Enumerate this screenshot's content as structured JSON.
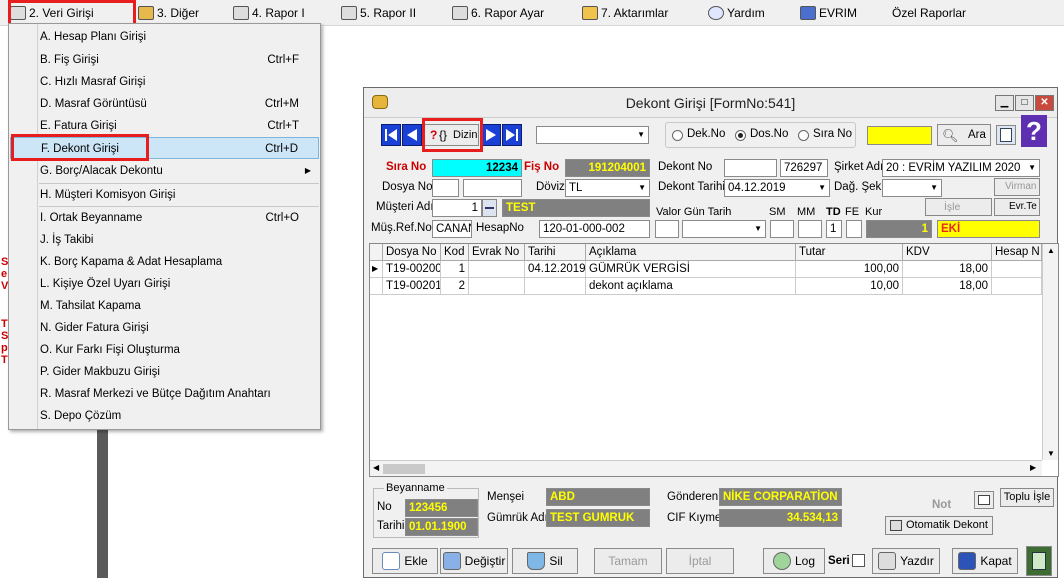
{
  "menubar": [
    {
      "id": "veri",
      "label": "2.  Veri Girişi",
      "icon": "pencil-icon"
    },
    {
      "id": "diger",
      "label": "3.  Diğer",
      "icon": "people-icon"
    },
    {
      "id": "rapor1",
      "label": "4.  Rapor I",
      "icon": "printer-icon"
    },
    {
      "id": "rapor2",
      "label": "5.  Rapor II",
      "icon": "printer-icon"
    },
    {
      "id": "raporayar",
      "label": "6.  Rapor Ayar",
      "icon": "list-icon"
    },
    {
      "id": "aktarim",
      "label": "7.  Aktarımlar",
      "icon": "transfer-icon"
    },
    {
      "id": "yardim",
      "label": "Yardım",
      "icon": "help-icon"
    },
    {
      "id": "evrim",
      "label": "EVRIM",
      "icon": "book-icon"
    },
    {
      "id": "ozel",
      "label": "Özel Raporlar",
      "icon": ""
    }
  ],
  "side_labels": [
    "S",
    "e",
    "V",
    "T",
    "S",
    "p",
    "T"
  ],
  "dropdown": [
    {
      "label": "A.  Hesap Planı Girişi",
      "key": ""
    },
    {
      "label": "B.  Fiş Girişi",
      "key": "Ctrl+F"
    },
    {
      "label": "C.  Hızlı Masraf Girişi",
      "key": ""
    },
    {
      "label": "D.  Masraf Görüntüsü",
      "key": "Ctrl+M"
    },
    {
      "label": "E.  Fatura Girişi",
      "key": "Ctrl+T"
    },
    {
      "label": "F.  Dekont Girişi",
      "key": "Ctrl+D"
    },
    {
      "label": "G.  Borç/Alacak Dekontu",
      "key": "▶"
    },
    {
      "label": "H.  Müşteri Komisyon Girişi",
      "key": ""
    },
    {
      "label": "I.  Ortak Beyanname",
      "key": "Ctrl+O"
    },
    {
      "label": "J.  İş Takibi",
      "key": ""
    },
    {
      "label": "K.  Borç Kapama & Adat Hesaplama",
      "key": ""
    },
    {
      "label": "L.  Kişiye Özel Uyarı Girişi",
      "key": ""
    },
    {
      "label": "M.  Tahsilat Kapama",
      "key": ""
    },
    {
      "label": "N. Gider Fatura Girişi",
      "key": ""
    },
    {
      "label": "O. Kur Farkı Fişi Oluşturma",
      "key": ""
    },
    {
      "label": "P. Gider Makbuzu Girişi",
      "key": ""
    },
    {
      "label": "R. Masraf Merkezi ve Bütçe Dağıtım Anahtarı",
      "key": ""
    },
    {
      "label": "S. Depo Çözüm",
      "key": ""
    }
  ],
  "window": {
    "title": "Dekont Girişi [FormNo:541]",
    "dizin_label": "Dizin",
    "radio_dek": "Dek.No",
    "radio_dos": "Dos.No",
    "radio_sira": "Sıra No",
    "ara_label": "Ara"
  },
  "form": {
    "sira_no_label": "Sıra No",
    "sira_no": "12234",
    "fis_no_label": "Fiş No",
    "fis_no": "191204001",
    "dekont_no_label": "Dekont No",
    "dekont_no": "",
    "dekont_no2": "726297",
    "sirket_label": "Şirket Adı",
    "sirket": "20 : EVRİM YAZILIM  2020",
    "dosya_no_label": "Dosya No",
    "doviz_label": "Döviz",
    "doviz": "TL",
    "dekont_tarihi_label": "Dekont Tarihi",
    "dekont_tarihi": "04.12.2019",
    "dag_sek_label": "Dağ. Şek.",
    "virman_label": "Virman",
    "musteri_adi_label": "Müşteri Adı",
    "musteri_no": "1",
    "musteri_ad": "TEST",
    "valor_label": "Valor Gün Tarih",
    "sm_label": "SM",
    "mm_label": "MM",
    "td_label": "TD",
    "fe_label": "FE",
    "kur_label": "Kur",
    "td_value": "1",
    "kur_value": "1",
    "isle_label": "İşle",
    "evr_label": "Evr.Te",
    "mus_ref_label": "Müş.Ref.No",
    "mus_ref": "CANAN",
    "hesap_no_label": "HesapNo",
    "hesap_no": "120-01-000-002",
    "eki_value": "EKİ"
  },
  "grid": {
    "columns": [
      "Dosya No",
      "Kod",
      "Evrak No",
      "Tarihi",
      "Açıklama",
      "Tutar",
      "KDV",
      "Hesap N"
    ],
    "rows": [
      [
        "T19-00200",
        "1",
        "",
        "04.12.2019",
        "GÜMRÜK VERGİSİ",
        "100,00",
        "18,00",
        ""
      ],
      [
        "T19-00201",
        "2",
        "",
        "",
        "dekont açıklama",
        "10,00",
        "18,00",
        ""
      ]
    ]
  },
  "bottom": {
    "beyanname_label": "Beyanname",
    "no_label": "No",
    "no_value": "123456",
    "tarih_label": "Tarihi",
    "tarih_value": "01.01.1900",
    "mensei_label": "Menşei",
    "mensei_value": "ABD",
    "gumruk_label": "Gümrük Adı",
    "gumruk_value": "TEST GUMRUK",
    "gonderen_label": "Gönderen",
    "gonderen_value": "NİKE CORPARATİON",
    "cif_label": "CIF Kıymet",
    "cif_value": "34.534,13",
    "not_label": "Not",
    "toplu_label": "Toplu İşle",
    "otomatik_label": "Otomatik Dekont"
  },
  "buttons": {
    "ekle": "Ekle",
    "degistir": "Değiştir",
    "sil": "Sil",
    "tamam": "Tamam",
    "iptal": "İptal",
    "log": "Log",
    "seri": "Seri",
    "yazdir": "Yazdır",
    "kapat": "Kapat"
  }
}
